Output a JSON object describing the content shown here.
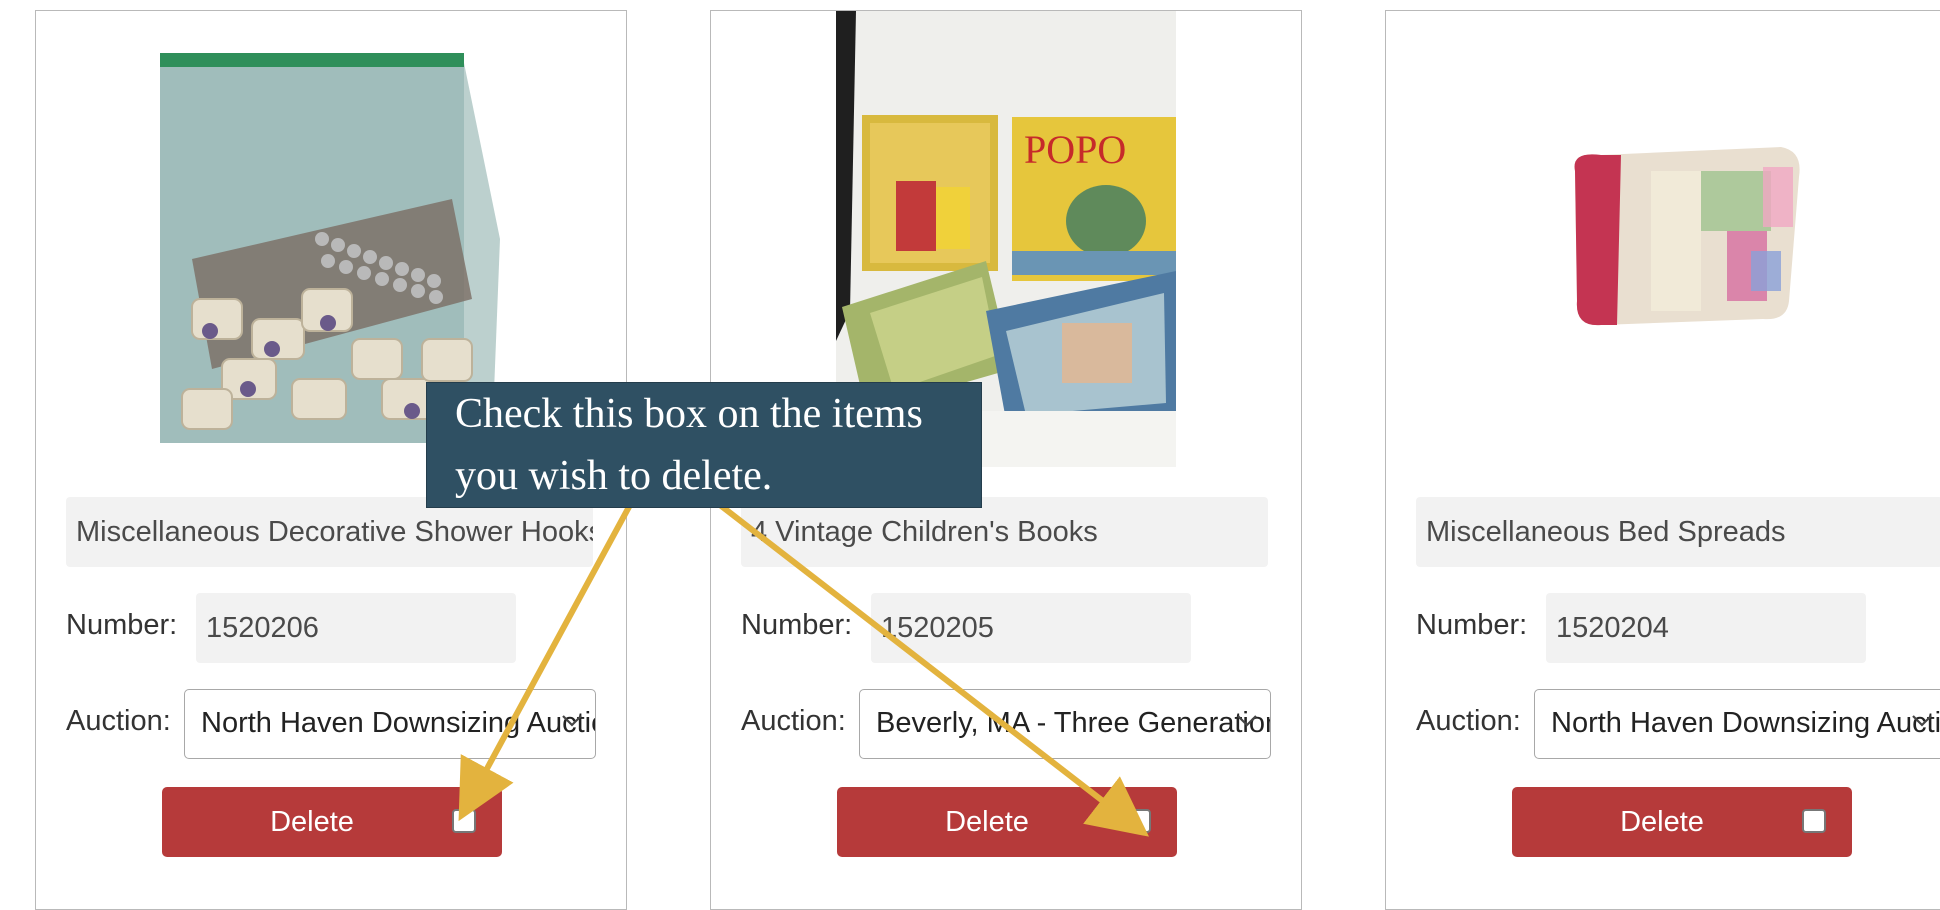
{
  "tooltip": {
    "text": "Check this box on the items you wish to delete."
  },
  "labels": {
    "number": "Number:",
    "auction": "Auction:",
    "delete": "Delete"
  },
  "items": [
    {
      "title": "Miscellaneous Decorative Shower Hooks",
      "number": "1520206",
      "auction": "North Haven Downsizing Auction"
    },
    {
      "title": "4 Vintage Children's Books",
      "number": "1520205",
      "auction": "Beverly, MA - Three Generations"
    },
    {
      "title": "Miscellaneous Bed Spreads",
      "number": "1520204",
      "auction": "North Haven Downsizing Auction"
    }
  ],
  "colors": {
    "delete_button": "#b63a3a",
    "tooltip_bg": "#2f5063",
    "arrow": "#e3b33e"
  }
}
